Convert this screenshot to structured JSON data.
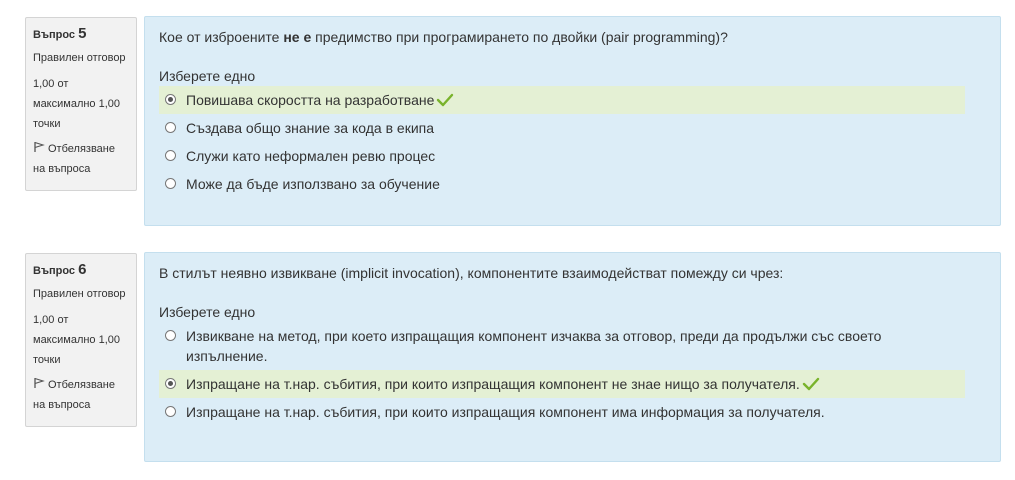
{
  "questions": [
    {
      "label": "Въпрос",
      "number": "5",
      "state": "Правилен отговор",
      "grade_line1": "1,00 от",
      "grade_line2": "максимално 1,00",
      "grade_line3": "точки",
      "flag_line1": "Отбелязване",
      "flag_line2": "на въпроса",
      "text_before": "Кое от изброените ",
      "text_bold": "не е",
      "text_after": " предимство при програмирането по двойки (pair programming)?",
      "prompt": "Изберете едно",
      "options": [
        {
          "label": "Повишава скоростта на разработване",
          "checked": true,
          "correct": true
        },
        {
          "label": "Създава общо знание за кода в екипа",
          "checked": false,
          "correct": false
        },
        {
          "label": "Служи като неформален ревю процес",
          "checked": false,
          "correct": false
        },
        {
          "label": "Може да бъде използвано за обучение",
          "checked": false,
          "correct": false
        }
      ]
    },
    {
      "label": "Въпрос",
      "number": "6",
      "state": "Правилен отговор",
      "grade_line1": "1,00 от",
      "grade_line2": "максимално 1,00",
      "grade_line3": "точки",
      "flag_line1": "Отбелязване",
      "flag_line2": "на въпроса",
      "text": "В стилът неявно извикване (implicit invocation), компонентите взаимодействат помежду си чрез:",
      "prompt": "Изберете едно",
      "options": [
        {
          "label": "Извикване на метод, при което изпращащия компонент изчаква за отговор, преди да продължи със своето изпълнение.",
          "checked": false,
          "correct": false
        },
        {
          "label": "Изпращане на т.нар. събития, при които изпращащия компонент не знае нищо за получателя.",
          "checked": true,
          "correct": true
        },
        {
          "label": "Изпращане на т.нар. събития, при които изпращащия компонент има информация за получателя.",
          "checked": false,
          "correct": false
        }
      ]
    }
  ],
  "colors": {
    "correct_check": "#79b32b",
    "correct_bg": "#e4f0d4",
    "content_bg": "#dcedf7"
  }
}
